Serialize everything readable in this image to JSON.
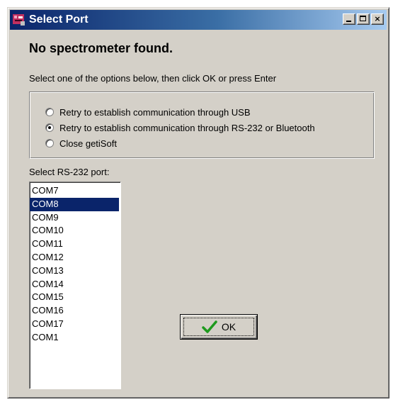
{
  "window": {
    "title": "Select Port",
    "title_icon": "app-icon",
    "controls": [
      "minimize-icon",
      "maximize-icon",
      "close-icon"
    ],
    "close_glyph": "×"
  },
  "dialog": {
    "heading": "No spectrometer found.",
    "instruction": "Select one of the options below, then click OK or press Enter",
    "options": [
      {
        "label": "Retry to establish communication through USB",
        "selected": false
      },
      {
        "label": "Retry to establish communication through RS-232 or Bluetooth",
        "selected": true
      },
      {
        "label": "Close getiSoft",
        "selected": false
      }
    ],
    "port_label": "Select RS-232 port:",
    "ports": [
      "COM7",
      "COM8",
      "COM9",
      "COM10",
      "COM11",
      "COM12",
      "COM13",
      "COM14",
      "COM15",
      "COM16",
      "COM17",
      "COM1"
    ],
    "selected_port": "COM8",
    "ok_button": {
      "label": "OK",
      "icon": "checkmark-icon"
    }
  },
  "colors": {
    "title_bar_start": "#0a246a",
    "title_bar_end": "#a6caf0",
    "face": "#d4d0c8",
    "selection": "#0a246a",
    "checkmark": "#1e9a1e"
  }
}
